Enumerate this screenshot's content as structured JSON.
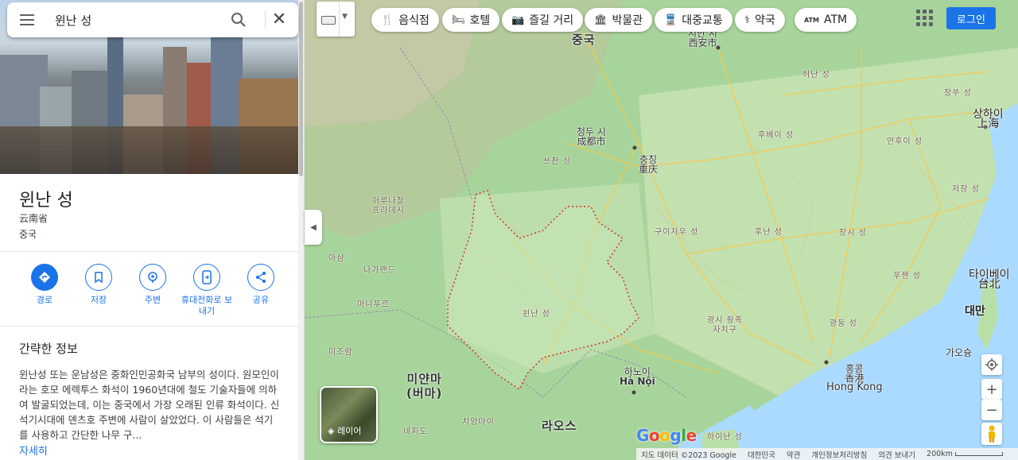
{
  "search": {
    "query": "윈난 성"
  },
  "place": {
    "title": "윈난 성",
    "native_name": "云南省",
    "country": "중국"
  },
  "actions": [
    {
      "label": "경로",
      "icon": "directions-icon"
    },
    {
      "label": "저장",
      "icon": "bookmark-icon"
    },
    {
      "label": "주변",
      "icon": "nearby-icon"
    },
    {
      "label": "휴대전화로 보내기",
      "icon": "send-to-phone-icon"
    },
    {
      "label": "공유",
      "icon": "share-icon"
    }
  ],
  "info": {
    "heading": "간략한 정보",
    "body": "윈난성 또는 운남성은 중화인민공화국 남부의 성이다. 원모인이라는 호모 에렉투스 화석이 1960년대에 철도 기술자들에 의하여 발굴되었는데, 이는 중국에서 가장 오래된 인류 화석이다. 신석기시대에 뎬츠호 주변에 사람이 살았었다. 이 사람들은 석기를 사용하고 간단한 나무 구...",
    "more": "자세히"
  },
  "chips": [
    {
      "label": "음식점",
      "icon": "restaurant-icon",
      "glyph": "🍴"
    },
    {
      "label": "호텔",
      "icon": "hotel-icon",
      "glyph": "🛏"
    },
    {
      "label": "즐길 거리",
      "icon": "camera-icon",
      "glyph": "📷"
    },
    {
      "label": "박물관",
      "icon": "museum-icon",
      "glyph": "🏛"
    },
    {
      "label": "대중교통",
      "icon": "transit-icon",
      "glyph": "🚆"
    },
    {
      "label": "약국",
      "icon": "pharmacy-icon",
      "glyph": "⚕"
    },
    {
      "label": "ATM",
      "icon": "atm-icon",
      "glyph": "ATM"
    }
  ],
  "login_label": "로그인",
  "layer_label": "레이어",
  "map_labels": {
    "china": "중국",
    "xian_ko": "시안 시",
    "xian_zh": "西安市",
    "chengdu_ko": "청두 시",
    "chengdu_zh": "成都市",
    "chongqing_ko": "충칭",
    "chongqing_zh": "重庆",
    "shanghai_ko": "상하이",
    "shanghai_zh": "上海",
    "taipei_ko": "타이베이",
    "taipei_zh": "台北",
    "taiwan": "대만",
    "hongkong_ko": "홍콩",
    "hongkong_zh": "香港",
    "hongkong_en": "Hong Kong",
    "hanoi_ko": "하노이",
    "hanoi_vi": "Hà Nội",
    "myanmar": "미얀마\n(버마)",
    "laos": "라오스",
    "yunnan": "윈난 성",
    "sichuan": "쓰촨 성",
    "guizhou": "구이저우 성",
    "hunan": "후난 성",
    "hubei": "후베이 성",
    "henan": "허난 성",
    "anhui": "안후이 성",
    "jiangsu": "장쑤 성",
    "zhejiang": "저장 성",
    "jiangxi": "장시 성",
    "fujian": "푸젠 성",
    "guangdong": "광둥 성",
    "guangxi": "광시 좡족\n자치구",
    "arunachal": "아루나찰\n프라데시",
    "assam": "아삼",
    "nagaland": "나가랜드",
    "manipur": "마니푸르",
    "mizoram": "미조람",
    "taiwan_city": "가오슝",
    "hainan": "하이난 성",
    "naypyidaw": "네피도",
    "chiangmai": "치앙마이"
  },
  "footer": {
    "data": "지도 데이터 ©2023 Google",
    "region": "대한민국",
    "terms": "약관",
    "privacy": "개인정보처리방침",
    "feedback": "의견 보내기",
    "scale": "200km"
  },
  "google_logo": "Google",
  "colors": {
    "accent": "#1a73e8",
    "border_dotted": "#d93025",
    "road": "#f6c94a"
  }
}
